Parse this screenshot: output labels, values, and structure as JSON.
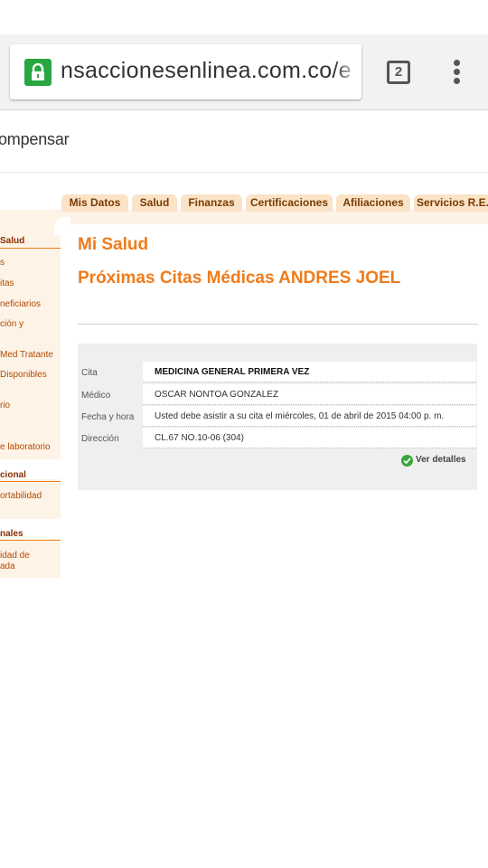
{
  "browser": {
    "url": "nsaccionesenlinea.com.co/e",
    "tab_count": "2"
  },
  "site": {
    "logo": "ompensar"
  },
  "nav": {
    "tabs": [
      "Mis Datos",
      "Salud",
      "Finanzas",
      "Certificaciones",
      "Afiliaciones",
      "Servicios R.E."
    ]
  },
  "sidebar": {
    "section1": "Salud",
    "items1": [
      "s",
      "itas",
      "neficiarios",
      "ción y",
      "Med Tratante",
      "Disponibles",
      "rio",
      "e laboratorio"
    ],
    "section2": "cional",
    "items2": [
      "ortabilidad"
    ],
    "section3": "nales",
    "items3": [
      "idad de",
      "ada"
    ]
  },
  "main": {
    "title": "Mi Salud",
    "subtitle": "Próximas Citas Médicas ANDRES JOEL",
    "rows": [
      {
        "label": "Cita",
        "value": "MEDICINA GENERAL PRIMERA VEZ"
      },
      {
        "label": "Médico",
        "value": "OSCAR NONTOA GONZALEZ"
      },
      {
        "label": "Fecha y hora",
        "value": "Usted debe asistir a su cita el miércoles, 01 de abril de 2015 04:00 p. m."
      },
      {
        "label": "Dirección",
        "value": "CL.67 NO.10-06 (304)"
      }
    ],
    "details_link": "Ver detalles"
  },
  "colors": {
    "accent": "#f07b1a",
    "nav_tab": "#fbe3c7",
    "sidebar_bg": "#fdf3e7",
    "lock_green": "#29a642"
  }
}
